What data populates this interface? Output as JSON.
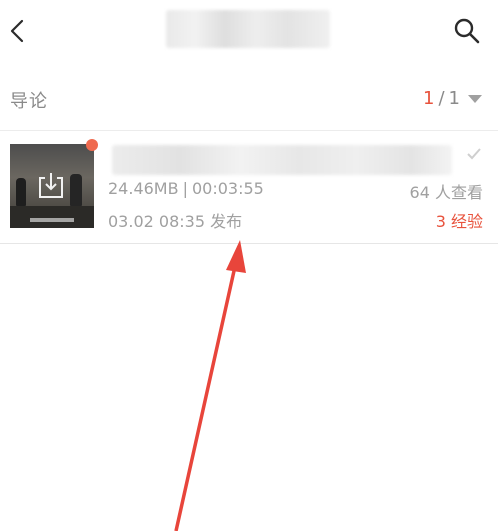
{
  "header": {
    "back_icon": "chevron-left-icon",
    "search_icon": "search-icon"
  },
  "section": {
    "title": "导论",
    "page_current": "1",
    "page_separator": "/",
    "page_total": "1"
  },
  "items": [
    {
      "size": "24.46MB",
      "duration": "00:03:55",
      "views": "64 人查看",
      "published": "03.02 08:35 发布",
      "experience": "3 经验",
      "thumb_icon": "download-icon"
    }
  ],
  "colors": {
    "accent": "#e8533d",
    "text_muted": "#a0a0a0",
    "annotation_arrow": "#e8453b"
  }
}
